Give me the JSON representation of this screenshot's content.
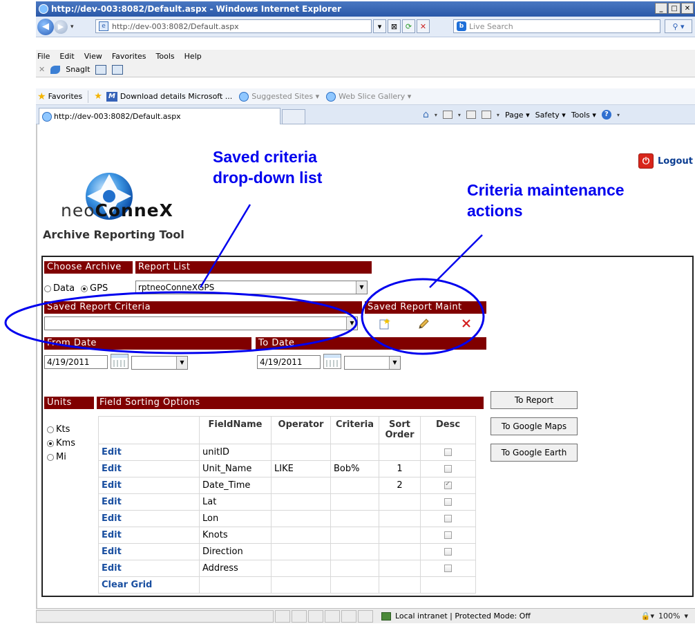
{
  "browser": {
    "title": "http://dev-003:8082/Default.aspx - Windows Internet Explorer",
    "address": "http://dev-003:8082/Default.aspx",
    "search_placeholder": "Live Search",
    "menu": [
      "File",
      "Edit",
      "View",
      "Favorites",
      "Tools",
      "Help"
    ],
    "snagit": "SnagIt",
    "favorites_label": "Favorites",
    "favorites": [
      "Download details Microsoft ...",
      "Suggested Sites ▾",
      "Web Slice Gallery ▾"
    ],
    "tab_title": "http://dev-003:8082/Default.aspx",
    "commands": [
      "Page ▾",
      "Safety ▾",
      "Tools ▾"
    ],
    "status_zone": "Local intranet | Protected Mode: Off",
    "zoom": "100%"
  },
  "page": {
    "brand_thin": "neo",
    "brand_bold": "ConneX",
    "tool_title": "Archive Reporting Tool",
    "logout": "Logout",
    "choose_archive": "Choose Archive",
    "report_list": "Report List",
    "archive_options": [
      "Data",
      "GPS"
    ],
    "report_list_value": "rptneoConneXGPS",
    "saved_criteria": "Saved Report Criteria",
    "saved_criteria_value": "",
    "saved_maint": "Saved Report Maint",
    "from_date_label": "From Date",
    "to_date_label": "To Date",
    "from_date": "4/19/2011",
    "to_date": "4/19/2011",
    "units_label": "Units",
    "units": [
      "Kts",
      "Kms",
      "Mi"
    ],
    "field_sorting": "Field Sorting Options",
    "buttons": [
      "To Report",
      "To Google Maps",
      "To Google Earth"
    ],
    "grid": {
      "headers": [
        "",
        "FieldName",
        "Operator",
        "Criteria",
        "Sort Order",
        "Desc"
      ],
      "rows": [
        {
          "edit": "Edit",
          "field": "unitID",
          "op": "",
          "crit": "",
          "sort": "",
          "desc": false
        },
        {
          "edit": "Edit",
          "field": "Unit_Name",
          "op": "LIKE",
          "crit": "Bob%",
          "sort": "1",
          "desc": false
        },
        {
          "edit": "Edit",
          "field": "Date_Time",
          "op": "",
          "crit": "",
          "sort": "2",
          "desc": true
        },
        {
          "edit": "Edit",
          "field": "Lat",
          "op": "",
          "crit": "",
          "sort": "",
          "desc": false
        },
        {
          "edit": "Edit",
          "field": "Lon",
          "op": "",
          "crit": "",
          "sort": "",
          "desc": false
        },
        {
          "edit": "Edit",
          "field": "Knots",
          "op": "",
          "crit": "",
          "sort": "",
          "desc": false
        },
        {
          "edit": "Edit",
          "field": "Direction",
          "op": "",
          "crit": "",
          "sort": "",
          "desc": false
        },
        {
          "edit": "Edit",
          "field": "Address",
          "op": "",
          "crit": "",
          "sort": "",
          "desc": false
        }
      ],
      "clear_grid": "Clear Grid"
    }
  },
  "annotations": {
    "saved_criteria_line1": "Saved criteria",
    "saved_criteria_line2": "drop-down list",
    "maint_line1": "Criteria maintenance",
    "maint_line2": "actions"
  }
}
